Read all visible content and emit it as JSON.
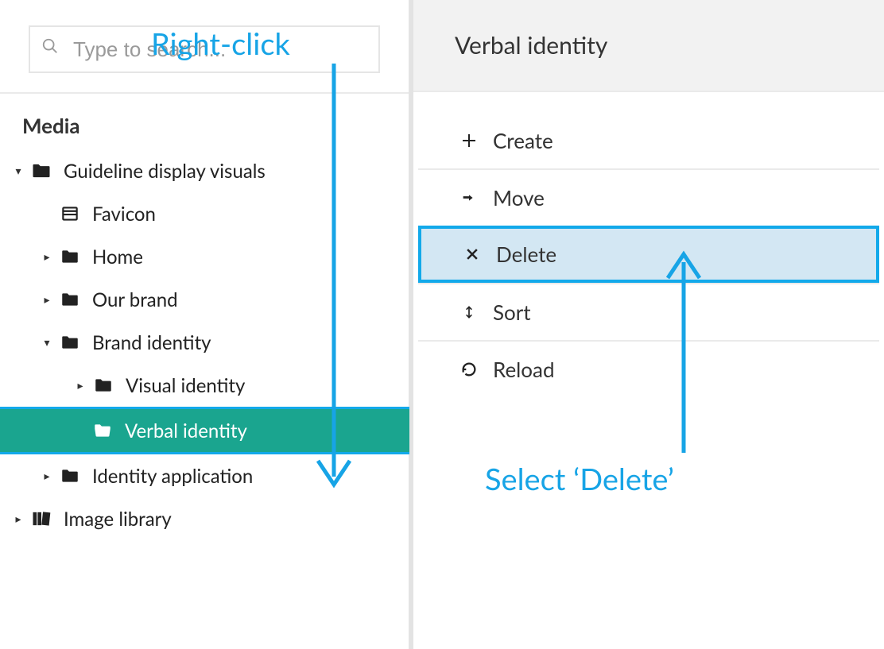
{
  "search": {
    "placeholder": "Type to search..."
  },
  "section_title": "Media",
  "tree": {
    "root": "Guideline display visuals",
    "favicon": "Favicon",
    "home": "Home",
    "our_brand": "Our brand",
    "brand_identity": "Brand identity",
    "visual_identity": "Visual identity",
    "verbal_identity": "Verbal identity",
    "identity_application": "Identity application",
    "image_library": "Image library"
  },
  "panel": {
    "title": "Verbal identity"
  },
  "menu": {
    "create": "Create",
    "move": "Move",
    "delete": "Delete",
    "sort": "Sort",
    "reload": "Reload"
  },
  "callouts": {
    "right_click": "Right-click",
    "select_delete": "Select ‘Delete’"
  }
}
